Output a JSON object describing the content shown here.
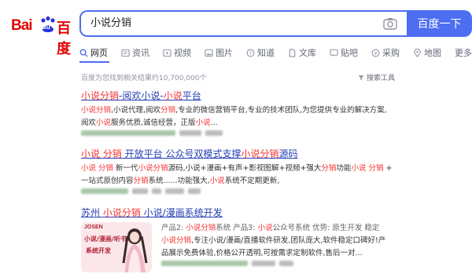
{
  "logo": {
    "part1": "Bai",
    "part2": "du",
    "part3": "百度"
  },
  "search": {
    "value": "小说分销",
    "button_label": "百度一下"
  },
  "tabs": [
    {
      "label": "网页",
      "icon": "search-icon"
    },
    {
      "label": "资讯",
      "icon": "news-icon"
    },
    {
      "label": "视频",
      "icon": "video-icon"
    },
    {
      "label": "图片",
      "icon": "image-icon"
    },
    {
      "label": "知道",
      "icon": "question-icon"
    },
    {
      "label": "文库",
      "icon": "document-icon"
    },
    {
      "label": "贴吧",
      "icon": "forum-icon"
    },
    {
      "label": "采购",
      "icon": "purchase-icon"
    },
    {
      "label": "地图",
      "icon": "map-pin-icon"
    },
    {
      "label": "更多",
      "icon": ""
    }
  ],
  "meta": {
    "result_count": "百度为您找到相关结果约10,700,000个",
    "tools_label": "搜索工具"
  },
  "results": [
    {
      "title_parts": [
        "小说分销",
        "-",
        "阅欢小说",
        "-",
        "小说",
        "平台"
      ],
      "desc_line1": [
        "小说分销",
        ",小说代理,阅欢",
        "分销",
        ",专业的微信营销平台,专业的技术团队,为您提供专业的解决方案,"
      ],
      "desc_line2": [
        "阅欢",
        "小说",
        "服务优质,诚信经营，正版",
        "小说",
        "..."
      ]
    },
    {
      "title_parts": [
        "小说 分销",
        " 开放平台 公众号双模式支撑",
        "小说分销",
        "源码"
      ],
      "desc_line1": [
        "小说 分销",
        " 新一代",
        "小说分销",
        "源码,小说+漫画+有声+影视图解+视频+强大",
        "分销",
        "功能",
        "小说 分销",
        " +"
      ],
      "desc_line2": [
        "一站式原创内容",
        "分销",
        "系统......功能强大,",
        "小说",
        "系统不定期更新,"
      ]
    },
    {
      "title_parts": [
        "苏州 ",
        "小说分销",
        " 小说/漫画系统开发"
      ],
      "line1": [
        "产品2: ",
        "小说分销",
        "系统    产品3: ",
        "小说",
        "公众号系统    优势: 原生开发 稳定"
      ],
      "line2": [
        "小说分销",
        ",专注小说/漫画/直播软件研发,团队庞大,软件稳定口碑好!产"
      ],
      "line3": [
        "品展示免费体验,价格公开透明,可按需求定制软件,售后一对..."
      ],
      "thumb": {
        "brand": "JOSEN",
        "line1": "小说/漫画/听书",
        "line2": "系统开发"
      }
    }
  ]
}
